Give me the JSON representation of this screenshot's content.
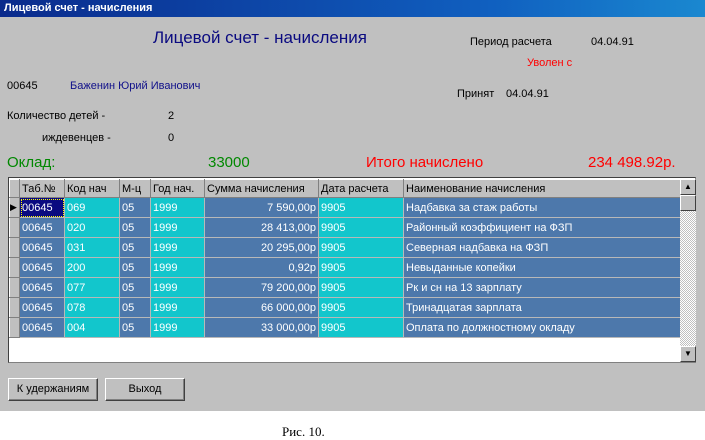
{
  "window_title": "Лицевой счет - начисления",
  "form_title": "Лицевой счет - начисления",
  "period_label": "Период расчета",
  "period_value": "04.04.91",
  "dismissed_label": "Уволен с",
  "hired_label": "Принят",
  "hired_value": "04.04.91",
  "employee_id": "00645",
  "employee_name": "Баженин Юрий Иванович",
  "children_label": "Количество детей -",
  "children_value": "2",
  "dependents_label": "иждевенцев -",
  "dependents_value": "0",
  "salary_label": "Оклад:",
  "salary_value": "33000",
  "total_label": "Итого начислено",
  "total_value": "234 498.92р.",
  "table": {
    "columns": [
      "Таб.№",
      "Код нач",
      "М-ц",
      "Год нач.",
      "Сумма начисления",
      "Дата расчета",
      "Наименование начисления"
    ],
    "rows": [
      [
        "00645",
        "069",
        "05",
        "1999",
        "7 590,00р",
        "9905",
        "Надбавка за стаж работы"
      ],
      [
        "00645",
        "020",
        "05",
        "1999",
        "28 413,00р",
        "9905",
        "Районный коэффициент на ФЗП"
      ],
      [
        "00645",
        "031",
        "05",
        "1999",
        "20 295,00р",
        "9905",
        "Северная надбавка на ФЗП"
      ],
      [
        "00645",
        "200",
        "05",
        "1999",
        "0,92р",
        "9905",
        "Невыданные копейки"
      ],
      [
        "00645",
        "077",
        "05",
        "1999",
        "79 200,00р",
        "9905",
        "Рк и сн на 13 зарплату"
      ],
      [
        "00645",
        "078",
        "05",
        "1999",
        "66 000,00р",
        "9905",
        "Тринадцатая зарплата"
      ],
      [
        "00645",
        "004",
        "05",
        "1999",
        "33 000,00р",
        "9905",
        "Оплата по должностному окладу"
      ]
    ]
  },
  "buttons": {
    "deductions": "К удержаниям",
    "exit": "Выход"
  },
  "caption": "Рис. 10."
}
